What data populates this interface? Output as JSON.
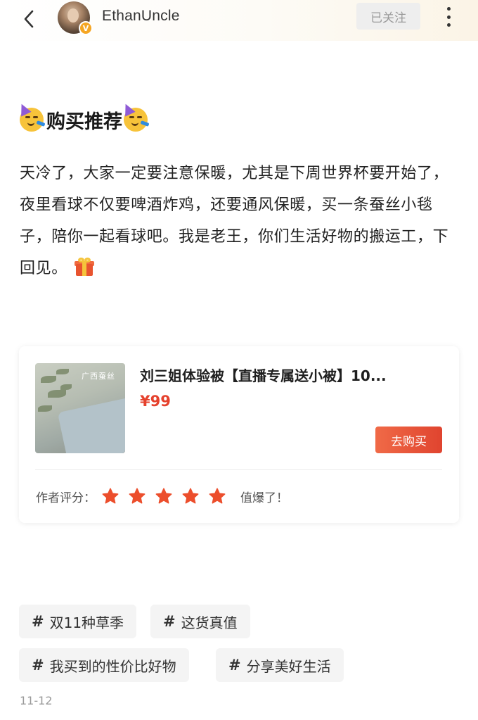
{
  "header": {
    "username": "EthanUncle",
    "verified_badge": "V",
    "follow_label": "已关注",
    "icons": [
      "chevron-left-icon",
      "avatar",
      "more-vertical-icon"
    ]
  },
  "post": {
    "title": "购买推荐",
    "title_emoji": "partying-face-emoji",
    "body": "天冷了，大家一定要注意保暖，尤其是下周世界杯要开始了，夜里看球不仅要啤酒炸鸡，还要通风保暖，买一条蚕丝小毯子，陪你一起看球吧。我是老王，你们生活好物的搬运工，下回见。",
    "body_emoji": "gift-emoji"
  },
  "product": {
    "image_brand": "广西蚕丝",
    "title": "刘三姐体验被【直播专属送小被】10...",
    "price": "¥99",
    "buy_label": "去购买",
    "rating_label": "作者评分：",
    "rating_stars": 5,
    "rating_max": 5,
    "rating_comment": "值爆了！"
  },
  "tags": [
    {
      "hash": "#",
      "label": "双11种草季"
    },
    {
      "hash": "#",
      "label": "这货真值"
    },
    {
      "hash": "#",
      "label": "我买到的性价比好物"
    },
    {
      "hash": "#",
      "label": "分享美好生活"
    }
  ],
  "date": "11-12",
  "colors": {
    "accent": "#e5412d",
    "buy_button": "#e9553a",
    "star": "#ec4e2c",
    "tag_bg": "#f4f4f4",
    "follow_bg": "#eeeeee"
  }
}
